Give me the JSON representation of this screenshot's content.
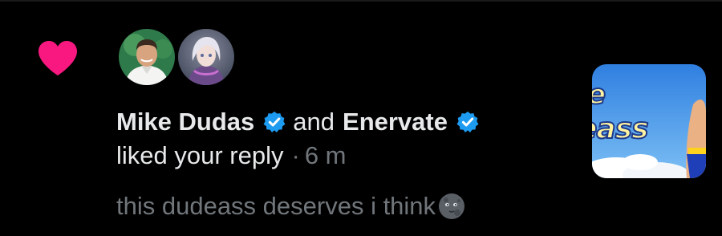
{
  "notification": {
    "type_icon": "heart-icon",
    "colors": {
      "heart": "#f91880",
      "verified_badge": "#1d9bf0",
      "primary_text": "#e7e9ea",
      "secondary_text": "#71767b",
      "background": "#000000"
    },
    "avatars": [
      {
        "alt": "Mike Dudas"
      },
      {
        "alt": "Enervate"
      }
    ],
    "user1": "Mike Dudas",
    "conjunction": "and",
    "user2": "Enervate",
    "action": "liked your reply",
    "separator": "·",
    "time": "6 m",
    "preview": "this dudeass deserves i think",
    "preview_emoji": "new-moon-face-icon",
    "thumbnail": {
      "text_line1": "e",
      "text_line2": "eass"
    }
  }
}
